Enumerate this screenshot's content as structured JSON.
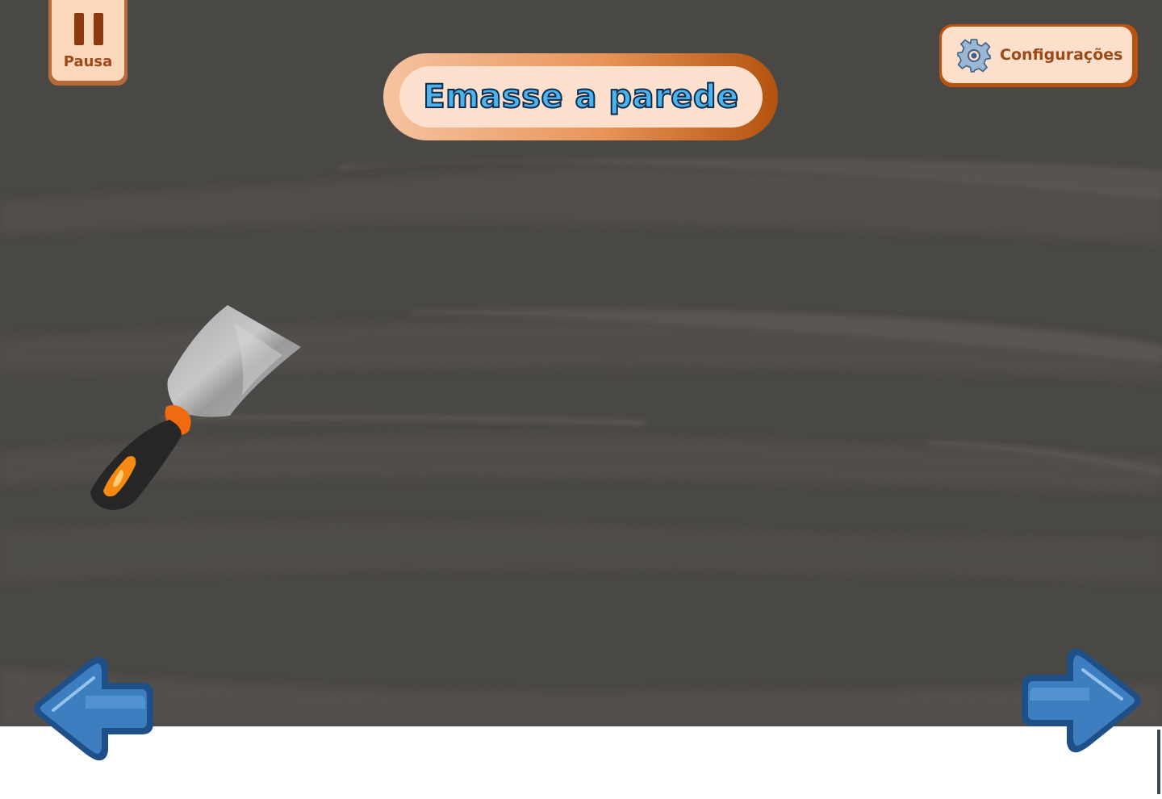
{
  "game": {
    "title": "Emasse a parede"
  },
  "controls": {
    "pause_label": "Pausa",
    "settings_label": "Configurações"
  },
  "tools": {
    "current_tool": "putty-knife"
  },
  "navigation": {
    "previous": "arrow-left-icon",
    "next": "arrow-right-icon"
  },
  "colors": {
    "wall": "#4a4845",
    "title_text": "#4ab4ee",
    "accent_orange": "#b9530f",
    "panel_light": "#fde0cb",
    "arrow_blue": "#3d7ec0"
  }
}
